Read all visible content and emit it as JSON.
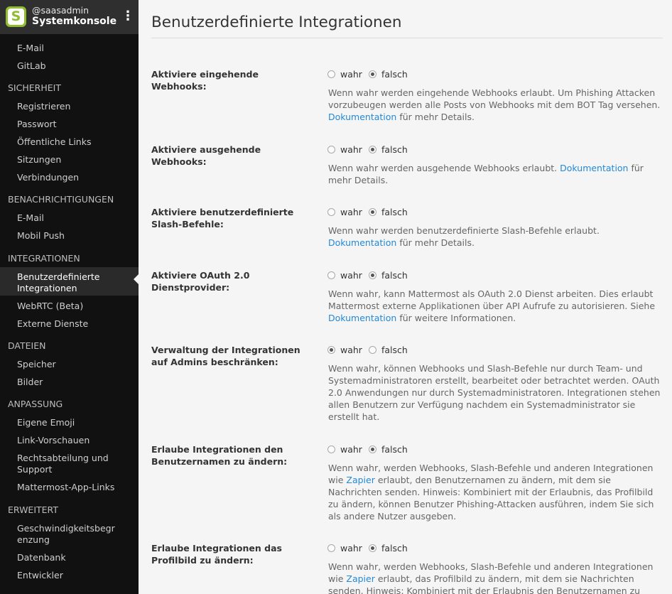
{
  "sidebar": {
    "username": "@saasadmin",
    "team": "Systemkonsole",
    "logo_letter": "S",
    "menu_icon": "⋮",
    "items_top": [
      "E-Mail",
      "GitLab"
    ],
    "sections": [
      {
        "title": "SICHERHEIT",
        "items": [
          "Registrieren",
          "Passwort",
          "Öffentliche Links",
          "Sitzungen",
          "Verbindungen"
        ]
      },
      {
        "title": "BENACHRICHTIGUNGEN",
        "items": [
          "E-Mail",
          "Mobil Push"
        ]
      },
      {
        "title": "INTEGRATIONEN",
        "items": [
          "Benutzerdefinierte Integrationen",
          "WebRTC (Beta)",
          "Externe Dienste"
        ]
      },
      {
        "title": "DATEIEN",
        "items": [
          "Speicher",
          "Bilder"
        ]
      },
      {
        "title": "ANPASSUNG",
        "items": [
          "Eigene Emoji",
          "Link-Vorschauen",
          "Rechtsabteilung und Support",
          "Mattermost-App-Links"
        ]
      },
      {
        "title": "ERWEITERT",
        "items": [
          "Geschwindigkeitsbegrenzung",
          "Datenbank",
          "Entwickler"
        ]
      }
    ]
  },
  "main": {
    "title": "Benutzerdefinierte Integrationen",
    "true_label": "wahr",
    "false_label": "falsch",
    "link_text": "Dokumentation",
    "zapier": "Zapier",
    "settings": [
      {
        "label": "Aktiviere eingehende Webhooks:",
        "selected": "false",
        "help_pre": "Wenn wahr werden eingehende Webhooks erlaubt. Um Phishing Attacken vorzubeugen werden alle Posts von Webhooks mit dem BOT Tag versehen.",
        "help_post": "für mehr Details."
      },
      {
        "label": "Aktiviere ausgehende Webhooks:",
        "selected": "false",
        "help_pre": "Wenn wahr werden ausgehende Webhooks erlaubt.",
        "help_post": "für mehr Details."
      },
      {
        "label": "Aktiviere benutzerdefinierte Slash-Befehle:",
        "selected": "false",
        "help_pre": "Wenn wahr werden benutzerdefinierte Slash-Befehle erlaubt.",
        "help_post": "für mehr Details."
      },
      {
        "label": "Aktiviere OAuth 2.0 Dienstprovider:",
        "selected": "false",
        "help_pre": "Wenn wahr, kann Mattermost als OAuth 2.0 Dienst arbeiten. Dies erlaubt Mattermost externe Applikationen über API Aufrufe zu autorisieren. Siehe",
        "help_post": "für weitere Informationen."
      },
      {
        "label": "Verwaltung der Integrationen auf Admins beschränken:",
        "selected": "true",
        "help": "Wenn wahr, können Webhooks und Slash-Befehle nur durch Team- und Systemadministratoren erstellt, bearbeitet oder betrachtet werden. OAuth 2.0 Anwendungen nur durch Systemadministratoren. Integrationen stehen allen Benutzern zur Verfügung nachdem ein Systemadministrator sie erstellt hat."
      },
      {
        "label": "Erlaube Integrationen den Benutzernamen zu ändern:",
        "selected": "false",
        "help_pre": "Wenn wahr, werden Webhooks, Slash-Befehle und anderen Integrationen wie",
        "help_post": "erlaubt, den Benutzernamen zu ändern, mit dem sie Nachrichten senden. Hinweis: Kombiniert mit der Erlaubnis, das Profilbild zu ändern, können Benutzer Phishing-Attacken ausführen, indem Sie sich als andere Nutzer ausgeben."
      },
      {
        "label": "Erlaube Integrationen das Profilbild zu ändern:",
        "selected": "false",
        "help_pre": "Wenn wahr, werden Webhooks, Slash-Befehle und anderen Integrationen wie",
        "help_post": "erlaubt, das Profilbild zu ändern, mit dem sie Nachrichten senden. Hinweis: Kombiniert mit der Erlaubnis den Benutzernamen zu ändern,"
      }
    ]
  }
}
